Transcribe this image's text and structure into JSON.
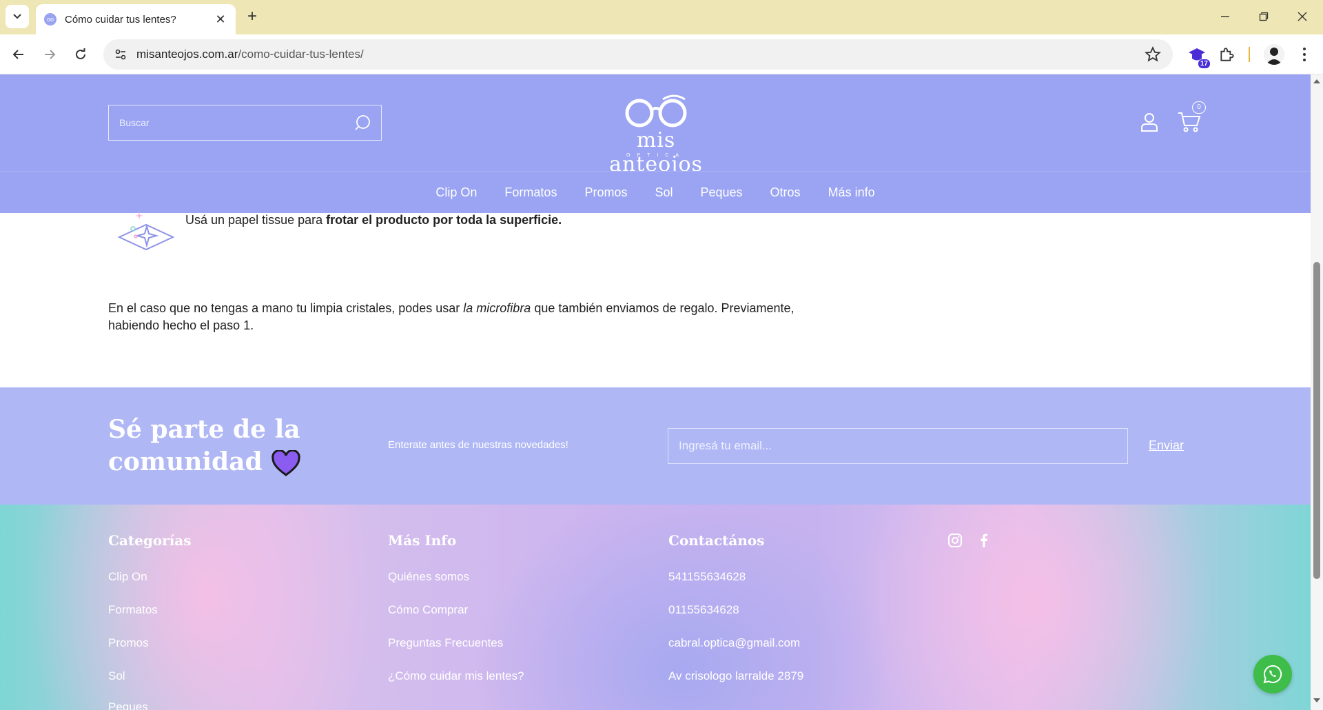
{
  "browser": {
    "tab_title": "Cómo cuidar tus lentes?",
    "favicon_text": "oo",
    "url_domain": "misanteojos.com.ar",
    "url_path": "/como-cuidar-tus-lentes/",
    "extension_badge": "17"
  },
  "header": {
    "search_placeholder": "Buscar",
    "logo_text": "mis anteojos",
    "logo_subtext": "OPTICA",
    "cart_count": "0"
  },
  "nav": {
    "items": [
      "Clip On",
      "Formatos",
      "Promos",
      "Sol",
      "Peques",
      "Otros",
      "Más info"
    ]
  },
  "content": {
    "step_text_plain": "Usá un papel tissue para ",
    "step_text_bold": "frotar el producto por toda la superficie.",
    "para_part1": "En el caso que no tengas a mano tu limpia cristales, podes usar ",
    "para_italic": "la microfibra",
    "para_part2": " que también enviamos de regalo. Previamente, habiendo hecho el paso 1."
  },
  "newsletter": {
    "title": "Sé parte de la comunidad",
    "subtitle": "Enterate antes de nuestras novedades!",
    "email_placeholder": "Ingresá tu email...",
    "send_label": "Enviar"
  },
  "footer": {
    "categories_title": "Categorías",
    "categories": [
      "Clip On",
      "Formatos",
      "Promos",
      "Sol",
      "Peques"
    ],
    "info_title": "Más Info",
    "info_links": [
      "Quiénes somos",
      "Cómo Comprar",
      "Preguntas Frecuentes",
      "¿Cómo cuidar mis lentes?"
    ],
    "contact_title": "Contactános",
    "contact": [
      "541155634628",
      "01155634628",
      "cabral.optica@gmail.com",
      "Av crisologo larralde 2879"
    ]
  },
  "colors": {
    "header_bg": "#9aa4f2",
    "newsletter_bg": "#afb7f5",
    "whatsapp": "#3fbd4a",
    "heart": "#8a5cf0"
  }
}
